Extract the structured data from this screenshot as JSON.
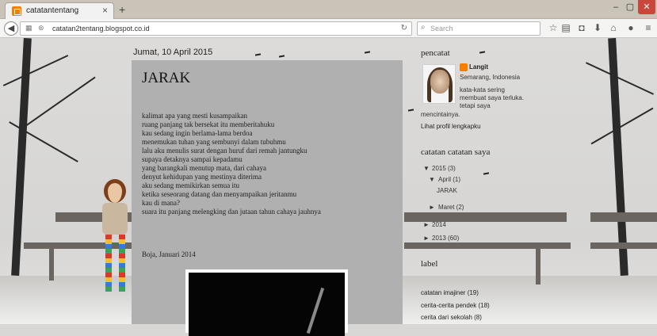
{
  "browser": {
    "tab_title": "catatantentang",
    "tab_close": "×",
    "new_tab": "+",
    "url": "catatan2tentang.blogspot.co.id",
    "search_placeholder": "Search",
    "win_min": "–",
    "win_max": "▢",
    "win_close": "✕"
  },
  "post": {
    "date": "Jumat, 10 April 2015",
    "title": "JARAK",
    "lines": [
      "kalimat apa yang mesti kusampaikan",
      "ruang panjang tak bersekat itu memberitahuku",
      "kau sedang ingin berlama-lama berdoa",
      "menemukan tuhan yang sembunyi dalam tubuhmu",
      "lalu aku menulis surat dengan huruf dari remah jantungku",
      "supaya detaknya sampai kepadamu",
      "yang barangkali menutup mata, dari cahaya",
      "denyut kehidupan yang mestinya diterima",
      "aku sedang memikirkan semua itu",
      "ketika seseorang datang dan menyampaikan jeritanmu",
      "kau di mana?",
      "suara itu panjang melengking dan jutaan tahun cahaya jauhnya"
    ],
    "signature": "Boja, Januari 2014"
  },
  "sidebar": {
    "profile_heading": "pencatat",
    "author_name": "Langit",
    "location": "Semarang, Indonesia",
    "bio_1": "kata-kata sering",
    "bio_2": "membuat saya terluka.",
    "bio_3": "tetapi saya",
    "bio_4": "mencintainya.",
    "profile_link": "Lihat profil lengkapku",
    "archive_heading": "catatan catatan saya",
    "archive": {
      "y2015": "2015 (3)",
      "april": "April (1)",
      "post": "JARAK",
      "maret": "Maret (2)",
      "y2014": "2014",
      "y2013": "2013 (60)"
    },
    "label_heading": "label",
    "labels": [
      "catatan imajiner (19)",
      "cerita-cerita pendek (18)",
      "cerita dari sekolah (8)"
    ]
  }
}
